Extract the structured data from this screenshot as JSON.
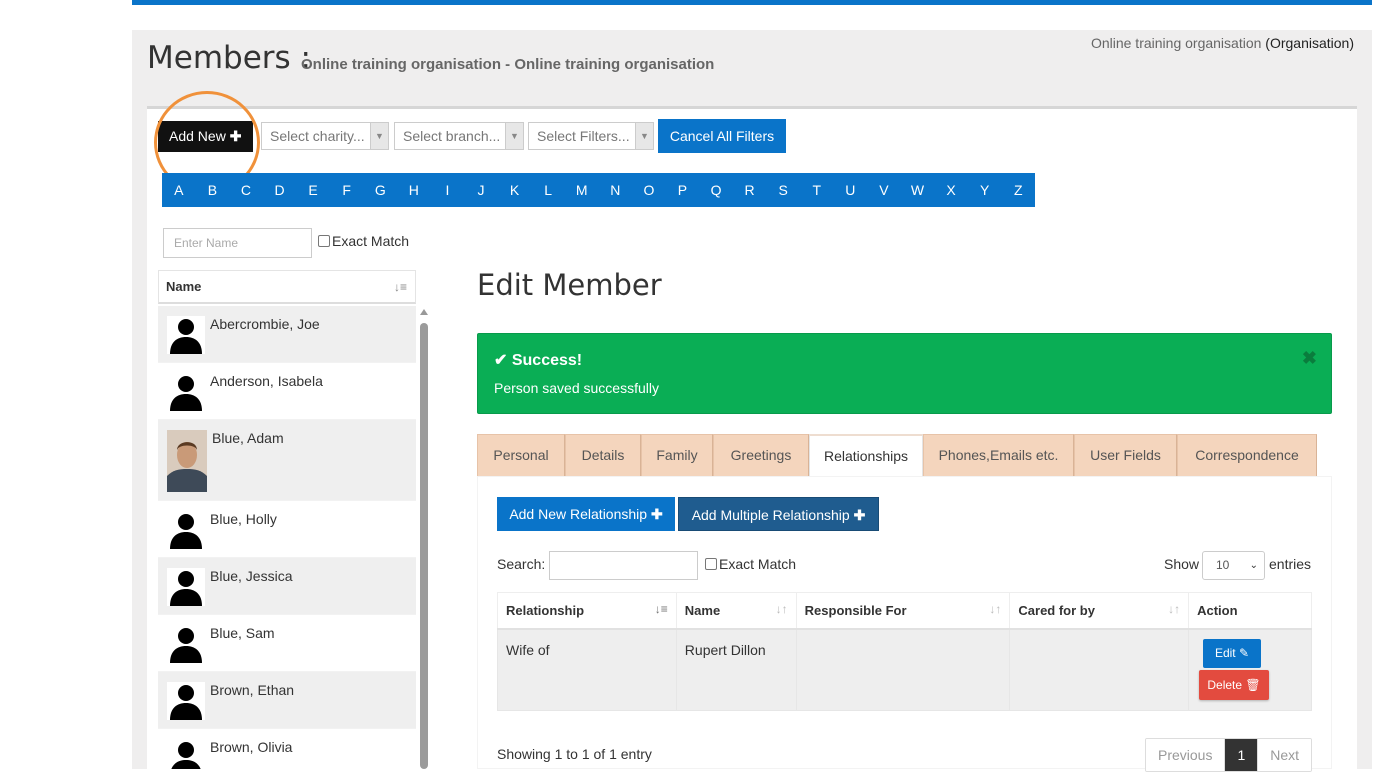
{
  "header": {
    "title": "Members :",
    "subtitle": "Online training organisation - Online training organisation",
    "org_name": "Online training organisation",
    "org_type": "(Organisation)"
  },
  "toolbar": {
    "add_new_label": "Add New",
    "charity_placeholder": "Select charity...",
    "branch_placeholder": "Select branch...",
    "filters_placeholder": "Select Filters...",
    "cancel_filters_label": "Cancel All Filters"
  },
  "alphabet": [
    "A",
    "B",
    "C",
    "D",
    "E",
    "F",
    "G",
    "H",
    "I",
    "J",
    "K",
    "L",
    "M",
    "N",
    "O",
    "P",
    "Q",
    "R",
    "S",
    "T",
    "U",
    "V",
    "W",
    "X",
    "Y",
    "Z"
  ],
  "name_filter": {
    "placeholder": "Enter Name",
    "exact_match_label": "Exact Match"
  },
  "member_list": {
    "header": "Name",
    "members": [
      {
        "name": "Abercrombie, Joe",
        "avatar": "silhouette-icon"
      },
      {
        "name": "Anderson, Isabela",
        "avatar": "silhouette-icon"
      },
      {
        "name": "Blue, Adam",
        "avatar": "photo"
      },
      {
        "name": "Blue, Holly",
        "avatar": "silhouette-icon"
      },
      {
        "name": "Blue, Jessica",
        "avatar": "silhouette-icon"
      },
      {
        "name": "Blue, Sam",
        "avatar": "silhouette-icon"
      },
      {
        "name": "Brown, Ethan",
        "avatar": "silhouette-icon"
      },
      {
        "name": "Brown, Olivia",
        "avatar": "silhouette-icon"
      }
    ]
  },
  "edit_member": {
    "title": "Edit Member",
    "alert": {
      "title": "Success!",
      "message": "Person saved successfully"
    },
    "tabs": [
      "Personal",
      "Details",
      "Family",
      "Greetings",
      "Relationships",
      "Phones,Emails etc.",
      "User Fields",
      "Correspondence"
    ],
    "active_tab": "Relationships",
    "relationships": {
      "add_new_label": "Add New Relationship",
      "add_multiple_label": "Add Multiple Relationship",
      "search_label": "Search:",
      "exact_match_label": "Exact Match",
      "show_label": "Show",
      "page_size": "10",
      "entries_label": "entries",
      "columns": [
        "Relationship",
        "Name",
        "Responsible For",
        "Cared for by",
        "Action"
      ],
      "rows": [
        {
          "relationship": "Wife of",
          "name": "Rupert Dillon",
          "responsible_for": "",
          "cared_for_by": ""
        }
      ],
      "edit_label": "Edit",
      "delete_label": "Delete",
      "showing_text": "Showing 1 to 1 of 1 entry",
      "pagination": {
        "previous": "Previous",
        "current": "1",
        "next": "Next"
      }
    }
  },
  "colors": {
    "brand_blue": "#0a74c9",
    "success_green": "#0aae55",
    "tab_peach": "#f4d5bd",
    "danger_red": "#e34b3f",
    "highlight_ring": "#f0913a"
  }
}
